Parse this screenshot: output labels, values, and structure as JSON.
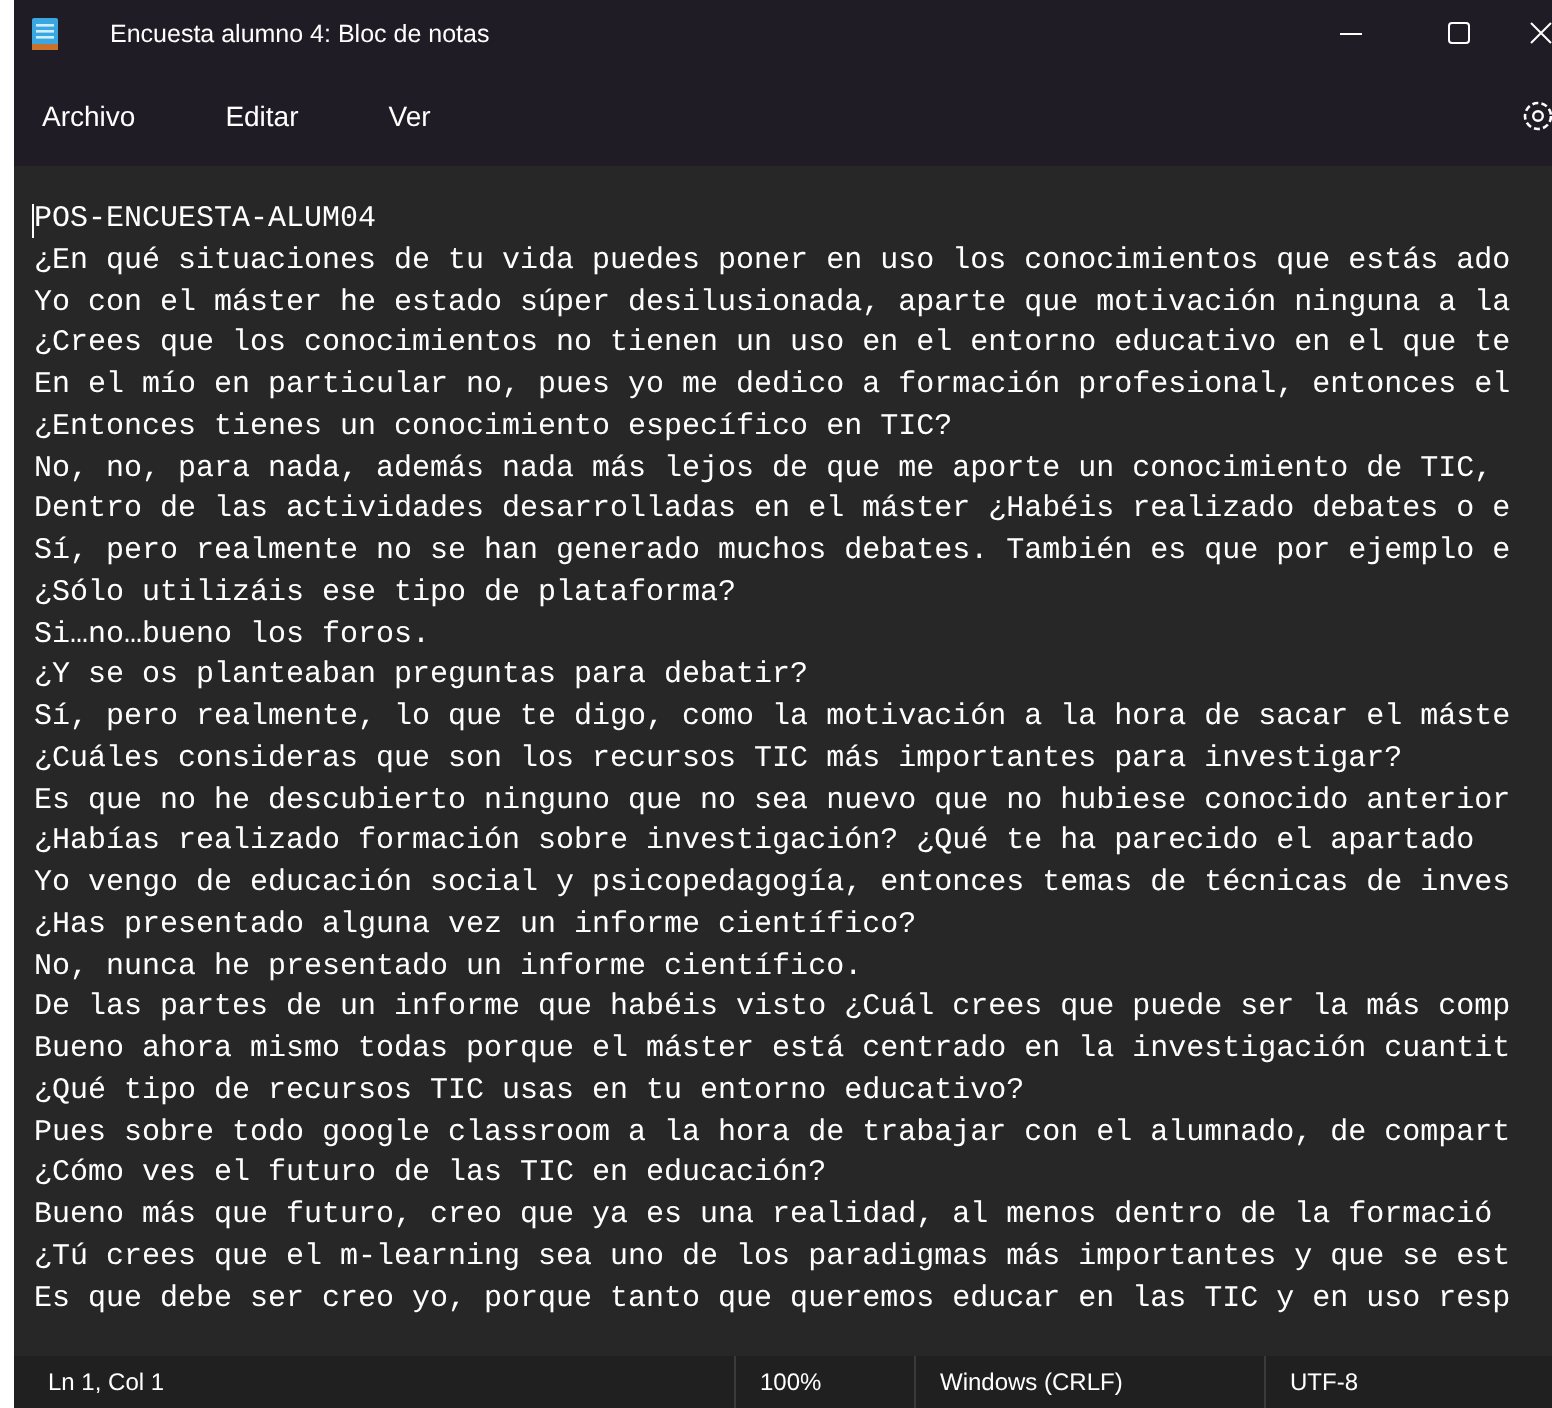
{
  "window": {
    "title": "Encuesta alumno 4: Bloc de notas"
  },
  "menu": [
    "Archivo",
    "Editar",
    "Ver"
  ],
  "document": {
    "lines": [
      "POS-ENCUESTA-ALUM04",
      "¿En qué situaciones de tu vida puedes poner en uso los conocimientos que estás ado",
      "Yo con el máster he estado súper desilusionada, aparte que motivación ninguna a la",
      "¿Crees que los conocimientos no tienen un uso en el entorno educativo en el que te",
      "En el mío en particular no, pues yo me dedico a formación profesional, entonces el",
      "¿Entonces tienes un conocimiento específico en TIC?",
      "No, no, para nada, además nada más lejos de que me aporte un conocimiento de TIC,",
      "Dentro de las actividades desarrolladas en el máster ¿Habéis realizado debates o e",
      "Sí, pero realmente no se han generado muchos debates. También es que por ejemplo e",
      "¿Sólo utilizáis ese tipo de plataforma?",
      "Si…no…bueno los foros.",
      "¿Y se os planteaban preguntas para debatir?",
      "Sí, pero realmente, lo que te digo, como la motivación a la hora de sacar el máste",
      "¿Cuáles consideras que son los recursos TIC más importantes para investigar?",
      "Es que no he descubierto ninguno que no sea nuevo que no hubiese conocido anterior",
      "¿Habías realizado formación sobre investigación? ¿Qué te ha parecido el apartado",
      "Yo vengo de educación social y psicopedagogía, entonces temas de técnicas de inves",
      "¿Has presentado alguna vez un informe científico?",
      "No, nunca he presentado un informe científico.",
      "De las partes de un informe que habéis visto ¿Cuál crees que puede ser la más comp",
      "Bueno ahora mismo todas porque el máster está centrado en la investigación cuantit",
      "¿Qué tipo de recursos TIC usas en tu entorno educativo?",
      "Pues sobre todo google classroom a la hora de trabajar con el alumnado, de compart",
      "¿Cómo ves el futuro de las TIC en educación?",
      "Bueno más que futuro, creo que ya es una realidad, al menos dentro de la formació",
      "¿Tú crees que el m-learning sea uno de los paradigmas más importantes y que se est",
      "Es que debe ser creo yo, porque tanto que queremos educar en las TIC y en uso resp"
    ]
  },
  "status_bar": {
    "position": "Ln 1, Col 1",
    "zoom": "100%",
    "line_ending": "Windows (CRLF)",
    "encoding": "UTF-8"
  }
}
